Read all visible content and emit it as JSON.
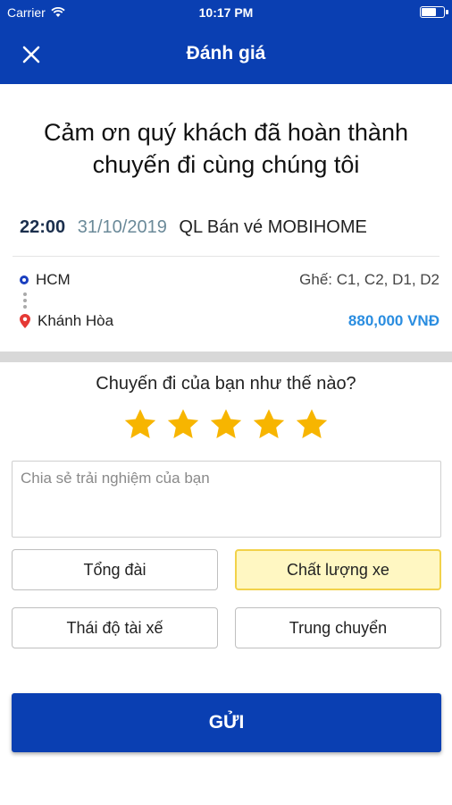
{
  "status_bar": {
    "carrier": "Carrier",
    "time": "10:17 PM"
  },
  "header": {
    "title": "Đánh giá",
    "close_icon": "close-icon"
  },
  "thanks_message": "Cảm ơn quý khách đã hoàn thành chuyến đi cùng chúng tôi",
  "trip": {
    "time": "22:00",
    "date": "31/10/2019",
    "operator": "QL Bán vé MOBIHOME",
    "from": "HCM",
    "to": "Khánh Hòa",
    "seats": "Ghế: C1, C2, D1, D2",
    "price": "880,000 VNĐ"
  },
  "rating": {
    "question": "Chuyến đi của bạn như thế nào?",
    "stars": 5,
    "max_stars": 5,
    "star_color": "#f7b500"
  },
  "comment": {
    "placeholder": "Chia sẻ trải nghiệm của bạn",
    "value": ""
  },
  "tags": [
    {
      "label": "Tổng đài",
      "selected": false
    },
    {
      "label": "Chất lượng xe",
      "selected": true
    },
    {
      "label": "Thái độ tài xế",
      "selected": false
    },
    {
      "label": "Trung chuyển",
      "selected": false
    }
  ],
  "submit_label": "GỬI",
  "colors": {
    "primary": "#0a3fb2",
    "price": "#2a8de0",
    "selected_bg": "#fff7c2",
    "selected_border": "#f2d24a"
  }
}
